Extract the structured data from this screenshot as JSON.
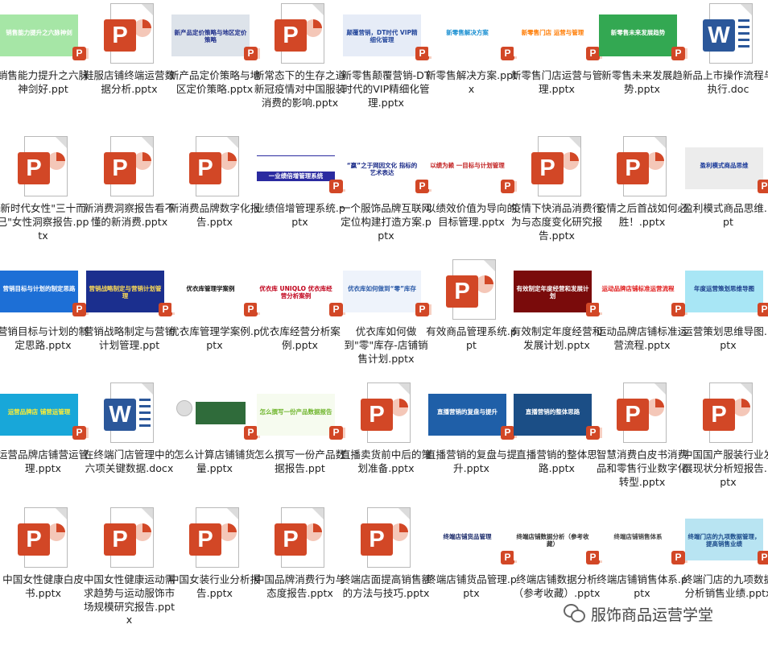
{
  "rows": [
    [
      {
        "thumb": "slide",
        "name": "销售能力提升之六脉神剑好.ppt",
        "slide_title": "销售能力提升之六脉神剑",
        "bg": "#a6e6a6",
        "fg": "#ffffff"
      },
      {
        "thumb": "ppt",
        "name": "鞋服店铺终端运营数据分析.pptx"
      },
      {
        "thumb": "slide",
        "name": "新产品定价策略与地区定价策略.pptx",
        "slide_title": "新产品定价策略与地区定价策略",
        "bg": "#dde3ea",
        "fg": "#1e2e8a"
      },
      {
        "thumb": "ppt",
        "name": "新常态下的生存之道新冠疫情对中国服装消费的影响.pptx"
      },
      {
        "thumb": "slide",
        "name": "新零售颠覆营销-DT时代的VIP精细化管理.pptx",
        "slide_title": "颠覆营销，DT时代 VIP精细化管理",
        "bg": "#e6ecf7",
        "fg": "#24479c"
      },
      {
        "thumb": "slide",
        "name": "新零售解决方案.pptx",
        "slide_title": "新零售解决方案",
        "bg": "#ffffff",
        "fg": "#1a8fd1"
      },
      {
        "thumb": "slide",
        "name": "新零售门店运营与管理.pptx",
        "slide_title": "新零售门店 运营与管理",
        "bg": "#ffffff",
        "fg": "#ff7a00"
      },
      {
        "thumb": "slide",
        "name": "新零售未来发展趋势.pptx",
        "slide_title": "新零售未来发展趋势",
        "bg": "#33a852",
        "fg": "#ffffff"
      },
      {
        "thumb": "word",
        "name": "新品上市操作流程与执行.doc"
      }
    ],
    [
      {
        "thumb": "ppt",
        "name": "新时代女性\"三十而已\"女性洞察报告.pptx"
      },
      {
        "thumb": "ppt",
        "name": "新消费洞察报告看不懂的新消费.pptx"
      },
      {
        "thumb": "ppt",
        "name": "新消费品牌数字化报告.pptx"
      },
      {
        "thumb": "slide",
        "name": "业绩倍增管理系统.pptx",
        "slide_title": "一业绩倍增管理系统",
        "bg": "#ffffff",
        "fg": "#ffffff",
        "band": "#2a2aa0"
      },
      {
        "thumb": "slide",
        "name": "一个服饰品牌互联网定位构建打造方案.pptx",
        "slide_title": "“赢”之于网因文化 指标的艺术表达",
        "bg": "#ffffff",
        "fg": "#1e2e8a"
      },
      {
        "thumb": "slide",
        "name": "以绩效价值为导向的目标管理.pptx",
        "slide_title": "以绩为赖 一目标与计划管理",
        "bg": "#ffffff",
        "fg": "#c22222"
      },
      {
        "thumb": "ppt",
        "name": "疫情下快消品消费行为与态度变化研究报告.pptx"
      },
      {
        "thumb": "ppt",
        "name": "疫情之后首战如何必胜！.pptx"
      },
      {
        "thumb": "slide",
        "name": "盈利模式商品思维.ppt",
        "slide_title": "盈利模式商品思维",
        "bg": "#ececec",
        "fg": "#1a3a9a"
      }
    ],
    [
      {
        "thumb": "slide",
        "name": "营销目标与计划的制定思路.pptx",
        "slide_title": "营销目标与计划的制定思路",
        "bg": "#1d6fd6",
        "fg": "#ffffff"
      },
      {
        "thumb": "slide",
        "name": "营销战略制定与营销计划管理.ppt",
        "slide_title": "营销战略制定与营销计划管理",
        "bg": "#1b2f8e",
        "fg": "#ffdd55"
      },
      {
        "thumb": "slide",
        "name": "优衣库管理学案例.pptx",
        "slide_title": "优衣库管理学案例",
        "bg": "#ffffff",
        "fg": "#111111"
      },
      {
        "thumb": "slide",
        "name": "优衣库经营分析案例.pptx",
        "slide_title": "优衣库 UNIQLO 优衣库经营分析案例",
        "bg": "#ffffff",
        "fg": "#c0001a"
      },
      {
        "thumb": "slide",
        "name": "优衣库如何做到\"零\"库存-店铺销售计划.pptx",
        "slide_title": "优衣库如何做到“零”库存",
        "bg": "#eef3fb",
        "fg": "#2a5aa8"
      },
      {
        "thumb": "ppt",
        "name": "有效商品管理系统.ppt"
      },
      {
        "thumb": "slide",
        "name": "有效制定年度经营和发展计划.pptx",
        "slide_title": "有效制定年度经营和发展计划",
        "bg": "#7a0b0b",
        "fg": "#ffffff"
      },
      {
        "thumb": "slide",
        "name": "运动品牌店铺标准运营流程.pptx",
        "slide_title": "运动品牌店铺标准运营流程",
        "bg": "#ffffff",
        "fg": "#e01a1a"
      },
      {
        "thumb": "slide",
        "name": "运营策划思维导图.pptx",
        "slide_title": "年度运营策划思维导图",
        "bg": "#a8e6f5",
        "fg": "#1a3c8a"
      }
    ],
    [
      {
        "thumb": "slide",
        "name": "运营品牌店铺营运管理.pptx",
        "slide_title": "运营品牌店 铺营运管理",
        "bg": "#18a7d9",
        "fg": "#ffee33"
      },
      {
        "thumb": "word",
        "name": "在终端门店管理中的六项关键数据.docx"
      },
      {
        "thumb": "slide",
        "name": "怎么计算店铺铺货量.pptx",
        "slide_title": "",
        "bg": "#ffffff",
        "fg": "#1a5e2a",
        "board": "#2f6b3a"
      },
      {
        "thumb": "slide",
        "name": "怎么撰写一份产品数据报告.ppt",
        "slide_title": "怎么撰写一份产品数据报告",
        "bg": "#f6fbef",
        "fg": "#6fb52c"
      },
      {
        "thumb": "ppt",
        "name": "直播卖货前中后的策划准备.pptx"
      },
      {
        "thumb": "slide",
        "name": "直播营销的复盘与提升.pptx",
        "slide_title": "直播营销的复盘与提升",
        "bg": "#1f5fa8",
        "fg": "#ffffff"
      },
      {
        "thumb": "slide",
        "name": "直播营销的整体思路.pptx",
        "slide_title": "直播营销的整体思路",
        "bg": "#1b4e86",
        "fg": "#ffffff"
      },
      {
        "thumb": "ppt",
        "name": "智慧消费白皮书消费品和零售行业数字化转型.pptx"
      },
      {
        "thumb": "ppt",
        "name": "中国国产服装行业发展现状分析短报告.pptx"
      }
    ],
    [
      {
        "thumb": "ppt",
        "name": "中国女性健康白皮书.pptx"
      },
      {
        "thumb": "ppt",
        "name": "中国女性健康运动需求趋势与运动服饰市场规模研究报告.pptx"
      },
      {
        "thumb": "ppt",
        "name": "中国女装行业分析报告.pptx"
      },
      {
        "thumb": "ppt",
        "name": "中国品牌消费行为与态度报告.pptx"
      },
      {
        "thumb": "ppt",
        "name": "终端店面提高销售额的方法与技巧.pptx"
      },
      {
        "thumb": "slide",
        "name": "终端店铺货品管理.pptx",
        "slide_title": "终端店铺货品管理",
        "bg": "#ffffff",
        "fg": "#1a2a6a"
      },
      {
        "thumb": "slide",
        "name": "终端店铺数据分析（参考收藏）.pptx",
        "slide_title": "终端店铺数据分析（参考收藏）",
        "bg": "#ffffff",
        "fg": "#333333"
      },
      {
        "thumb": "slide",
        "name": "终端店铺销售体系.pptx",
        "slide_title": "终端店铺销售体系",
        "bg": "#ffffff",
        "fg": "#444444"
      },
      {
        "thumb": "slide",
        "name": "终端门店的九项数据分析销售业绩.pptx",
        "slide_title": "终端门店的九项数据管理，提高销售业绩",
        "bg": "#b8e4f2",
        "fg": "#1a4a8a"
      }
    ]
  ],
  "watermark": {
    "text": "服饰商品运营学堂",
    "icon": "wechat-icon"
  }
}
